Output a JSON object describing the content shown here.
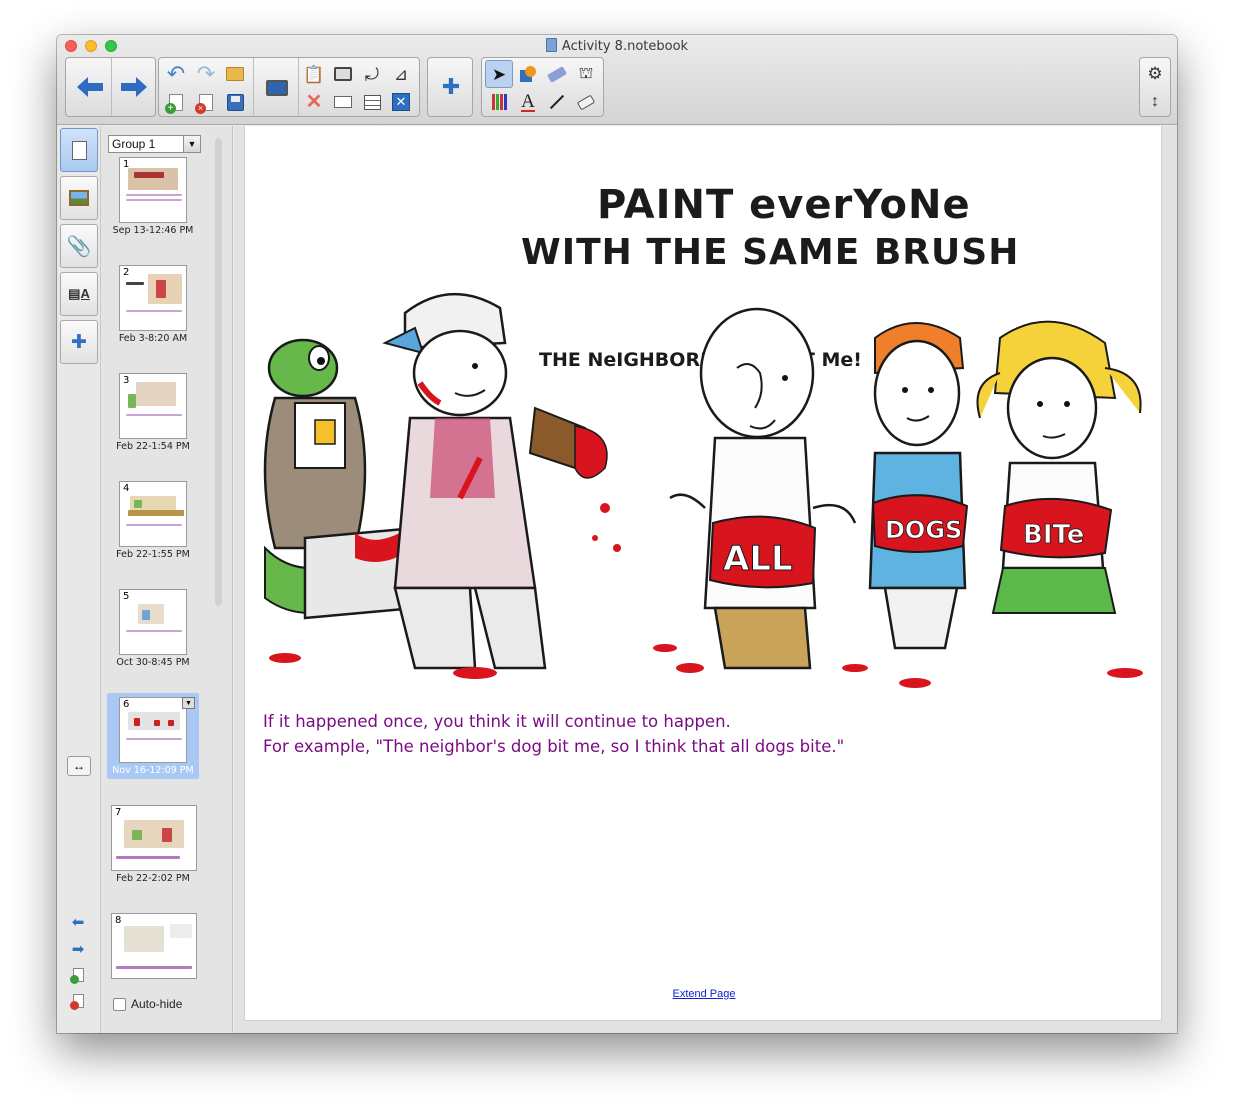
{
  "window": {
    "title": "Activity 8.notebook"
  },
  "toolbar": {
    "back": "back-arrow",
    "forward": "forward-arrow",
    "undo": "undo",
    "redo": "redo",
    "open": "open-folder",
    "add_page": "add-page",
    "delete_page": "delete-page",
    "save": "save",
    "screen": "screen-shade",
    "paste": "paste",
    "capture": "screen-capture",
    "rotate": "rotate",
    "measure": "measurement-tools",
    "delete": "delete",
    "document_camera": "document-camera",
    "table": "insert-table",
    "full_screen": "full-screen",
    "addon": "add-on",
    "select": "select",
    "shapes": "shapes",
    "eraser_pen": "magic-pen",
    "fill": "fill",
    "pens": "pens",
    "text": "text",
    "lines": "lines",
    "eraser": "eraser",
    "settings": "settings",
    "move_toolbar": "move-toolbar"
  },
  "sidebar": {
    "group_label": "Group 1",
    "autohide_label": "Auto-hide",
    "pages": [
      {
        "num": "1",
        "caption": "Sep 13-12:46 PM"
      },
      {
        "num": "2",
        "caption": "Feb 3-8:20 AM"
      },
      {
        "num": "3",
        "caption": "Feb 22-1:54 PM"
      },
      {
        "num": "4",
        "caption": "Feb 22-1:55 PM"
      },
      {
        "num": "5",
        "caption": "Oct 30-8:45 PM"
      },
      {
        "num": "6",
        "caption": "Nov 16-12:09 PM"
      },
      {
        "num": "7",
        "caption": "Feb 22-2:02 PM"
      },
      {
        "num": "8",
        "caption": ""
      }
    ]
  },
  "page": {
    "cartoon_title_line1": "PAINT everYoNe",
    "cartoon_title_line2": "WITH THE SAME BRUSH",
    "speech": "THE NeIGHBOR'S DOG BIT Me!",
    "shirt_words": [
      "ALL",
      "DOGS",
      "BITe"
    ],
    "text_line1": "If it happened once, you think it will continue to happen.",
    "text_line2": "For example, \"The neighbor's dog bit me, so I think that all dogs bite.\"",
    "extend_link": "Extend Page"
  }
}
